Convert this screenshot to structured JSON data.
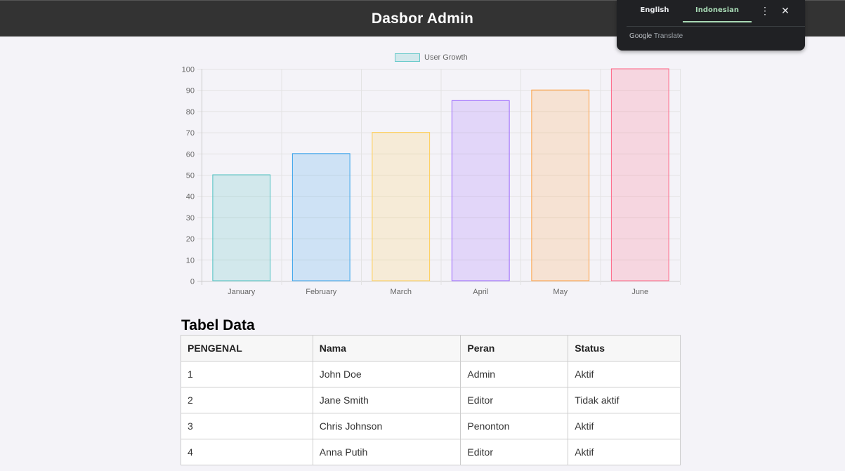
{
  "header": {
    "title": "Dasbor Admin"
  },
  "translate_popup": {
    "tabs": [
      "English",
      "Indonesian"
    ],
    "active_tab": "Indonesian",
    "brand_google": "Google",
    "brand_translate": "Translate",
    "more_icon": "more-vert-icon",
    "close_icon": "close-icon"
  },
  "chart_data": {
    "type": "bar",
    "categories": [
      "January",
      "February",
      "March",
      "April",
      "May",
      "June"
    ],
    "series": [
      {
        "name": "User Growth",
        "values": [
          50,
          60,
          70,
          85,
          90,
          100
        ]
      }
    ],
    "ylim": [
      0,
      100
    ],
    "yticks": [
      0,
      10,
      20,
      30,
      40,
      50,
      60,
      70,
      80,
      90,
      100
    ],
    "grid": true,
    "legend_position": "top",
    "bar_colors": [
      {
        "fill": "rgba(75,192,192,0.2)",
        "stroke": "rgba(75,192,192,1)"
      },
      {
        "fill": "rgba(54,162,235,0.2)",
        "stroke": "rgba(54,162,235,1)"
      },
      {
        "fill": "rgba(255,206,86,0.2)",
        "stroke": "rgba(255,206,86,1)"
      },
      {
        "fill": "rgba(153,102,255,0.2)",
        "stroke": "rgba(153,102,255,1)"
      },
      {
        "fill": "rgba(255,159,64,0.2)",
        "stroke": "rgba(255,159,64,1)"
      },
      {
        "fill": "rgba(255,99,132,0.2)",
        "stroke": "rgba(255,99,132,1)"
      }
    ]
  },
  "table": {
    "title": "Tabel Data",
    "headers": [
      "PENGENAL",
      "Nama",
      "Peran",
      "Status"
    ],
    "rows": [
      [
        "1",
        "John Doe",
        "Admin",
        "Aktif"
      ],
      [
        "2",
        "Jane Smith",
        "Editor",
        "Tidak aktif"
      ],
      [
        "3",
        "Chris Johnson",
        "Penonton",
        "Aktif"
      ],
      [
        "4",
        "Anna Putih",
        "Editor",
        "Aktif"
      ]
    ]
  }
}
